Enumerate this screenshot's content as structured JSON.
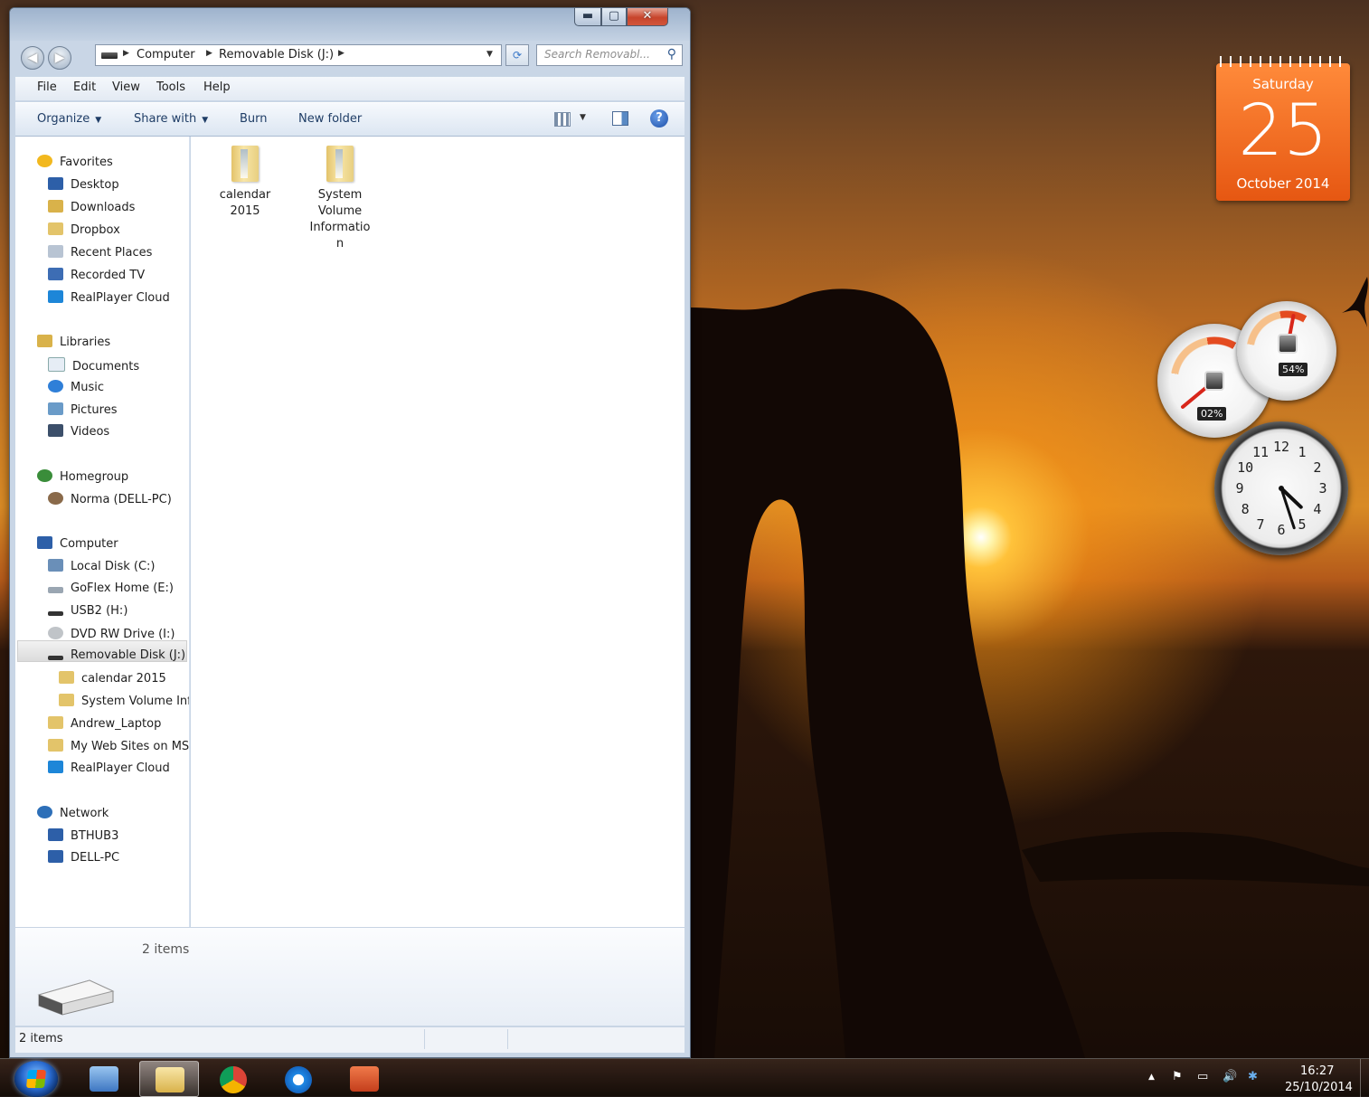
{
  "window": {
    "controls": {
      "minimize": "▬",
      "maximize": "▢",
      "close": "✕"
    },
    "nav": {
      "back": "◀",
      "forward": "▶"
    },
    "address": {
      "crumbs": [
        "Computer",
        "Removable Disk (J:)"
      ]
    },
    "search": {
      "placeholder": "Search Removabl..."
    },
    "menu": [
      "File",
      "Edit",
      "View",
      "Tools",
      "Help"
    ],
    "commands": {
      "organize": "Organize",
      "share_with": "Share with",
      "burn": "Burn",
      "new_folder": "New folder",
      "help": "?"
    },
    "nav_pane": {
      "favorites": {
        "label": "Favorites",
        "items": [
          "Desktop",
          "Downloads",
          "Dropbox",
          "Recent Places",
          "Recorded TV",
          "RealPlayer Cloud"
        ]
      },
      "libraries": {
        "label": "Libraries",
        "items": [
          "Documents",
          "Music",
          "Pictures",
          "Videos"
        ]
      },
      "homegroup": {
        "label": "Homegroup",
        "items": [
          "Norma (DELL-PC)"
        ]
      },
      "computer": {
        "label": "Computer",
        "items": [
          "Local Disk (C:)",
          "GoFlex Home (E:)",
          "USB2 (H:)",
          "DVD RW Drive (I:)",
          "Removable Disk (J:)"
        ],
        "subitems": [
          "calendar 2015",
          "System Volume Inf"
        ],
        "more": [
          "Andrew_Laptop",
          "My Web Sites on MS",
          "RealPlayer Cloud"
        ]
      },
      "network": {
        "label": "Network",
        "items": [
          "BTHUB3",
          "DELL-PC"
        ]
      }
    },
    "files": [
      {
        "line1": "calendar",
        "line2": "2015",
        "line3": "",
        "line4": ""
      },
      {
        "line1": "System",
        "line2": "Volume",
        "line3": "Informatio",
        "line4": "n"
      }
    ],
    "details": {
      "count": "2 items"
    },
    "status": {
      "text": "2 items"
    }
  },
  "gadgets": {
    "calendar": {
      "day": "Saturday",
      "date": "25",
      "month": "October 2014"
    },
    "cpu": {
      "readout": "02%",
      "value": 2
    },
    "memory": {
      "readout": "54%",
      "value": 54
    },
    "clock": {
      "hour": 4,
      "minute": 27,
      "numerals": [
        "12",
        "1",
        "2",
        "3",
        "4",
        "5",
        "6",
        "7",
        "8",
        "9",
        "10",
        "11"
      ]
    }
  },
  "taskbar": {
    "tray": {
      "arrow": "▲",
      "flag": "⚑",
      "network": "▭",
      "volume": "🔊",
      "app": "✱"
    },
    "time": "16:27",
    "date": "25/10/2014"
  },
  "colors": {
    "calendar": "#e65712",
    "accent": "#1f3d66"
  }
}
